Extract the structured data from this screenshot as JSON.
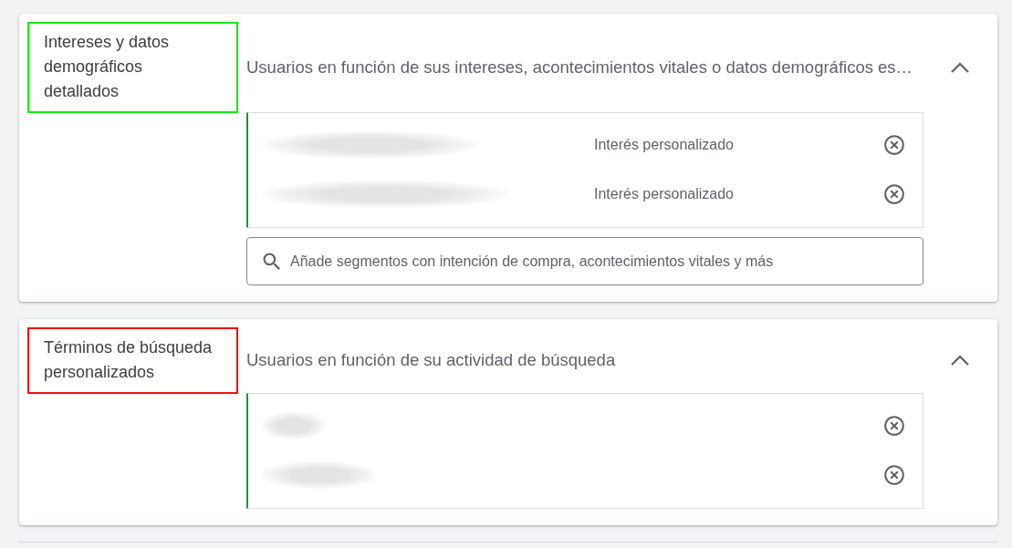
{
  "sections": [
    {
      "title": "Intereses y datos demográficos detallados",
      "color": "#11ee11",
      "description": "Usuarios en función de sus intereses, acontecimientos vitales o datos demográficos es…",
      "expanded": true,
      "items": [
        {
          "kind": "blurred",
          "type_label": "Interés personalizado"
        },
        {
          "kind": "blurred",
          "type_label": "Interés personalizado"
        }
      ],
      "search": {
        "placeholder": "Añade segmentos con intención de compra, acontecimientos vitales y más"
      }
    },
    {
      "title": "Términos de búsqueda personalizados",
      "color": "#ee1111",
      "description": "Usuarios en función de su actividad de búsqueda",
      "expanded": true,
      "items": [
        {
          "kind": "blurred"
        },
        {
          "kind": "blurred"
        }
      ]
    }
  ]
}
